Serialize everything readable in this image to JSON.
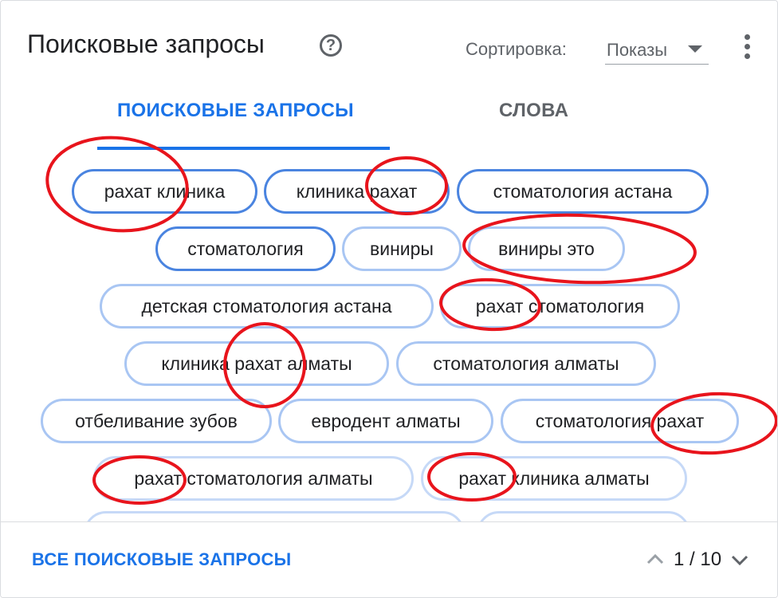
{
  "header": {
    "title": "Поисковые запросы",
    "help_icon": "help-circle-icon",
    "sort_label": "Сортировка:",
    "sort_value": "Показы",
    "more_icon": "more-vert-icon"
  },
  "tabs": [
    {
      "label": "ПОИСКОВЫЕ ЗАПРОСЫ",
      "active": true
    },
    {
      "label": "СЛОВА",
      "active": false
    }
  ],
  "chips": [
    "рахат клиника",
    "клиника рахат",
    "стоматология астана",
    "стоматология",
    "виниры",
    "виниры это",
    "детская стоматология астана",
    "рахат стоматология",
    "клиника рахат алматы",
    "стоматология алматы",
    "отбеливание зубов",
    "евродент алматы",
    "стоматология рахат",
    "рахат стоматология алматы",
    "рахат клиника алматы"
  ],
  "footer": {
    "all_link": "ВСЕ ПОИСКОВЫЕ ЗАПРОСЫ",
    "page_indicator": "1 / 10",
    "prev_icon": "chevron-up-icon",
    "next_icon": "chevron-down-icon"
  },
  "colors": {
    "accent": "#1a73e8",
    "annotation": "#e8141c"
  }
}
